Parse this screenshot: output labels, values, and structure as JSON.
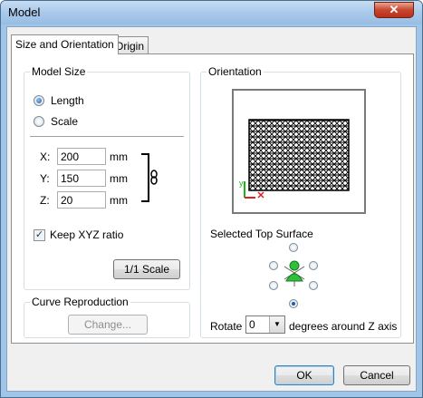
{
  "window": {
    "title": "Model",
    "close_glyph": "✕"
  },
  "tabs": [
    {
      "label": "Size and Orientation",
      "active": true
    },
    {
      "label": "Origin",
      "active": false
    }
  ],
  "model_size": {
    "label": "Model Size",
    "mode_options": [
      {
        "label": "Length",
        "selected": true
      },
      {
        "label": "Scale",
        "selected": false
      }
    ],
    "fields": [
      {
        "axis": "X:",
        "value": "200",
        "unit": "mm"
      },
      {
        "axis": "Y:",
        "value": "150",
        "unit": "mm"
      },
      {
        "axis": "Z:",
        "value": "20",
        "unit": "mm"
      }
    ],
    "link_icon": "chain-link-icon",
    "keep_ratio": {
      "label": "Keep XYZ ratio",
      "checked": true
    },
    "scale_button": "1/1 Scale"
  },
  "curve_reproduction": {
    "label": "Curve Reproduction",
    "change_button": "Change...",
    "enabled": false
  },
  "orientation": {
    "label": "Orientation",
    "preview_icon": "mesh-preview",
    "axis_y": "y",
    "top_surface_label": "Selected Top Surface",
    "selected_surface": "bottom",
    "rotate_label": "Rotate",
    "rotate_value": "0",
    "rotate_suffix": "degrees around Z axis"
  },
  "buttons": {
    "ok": "OK",
    "cancel": "Cancel"
  },
  "colors": {
    "mesh": "#000000",
    "axis_x": "#e02020",
    "axis_y": "#20b020",
    "figure": "#2fbf3a"
  }
}
